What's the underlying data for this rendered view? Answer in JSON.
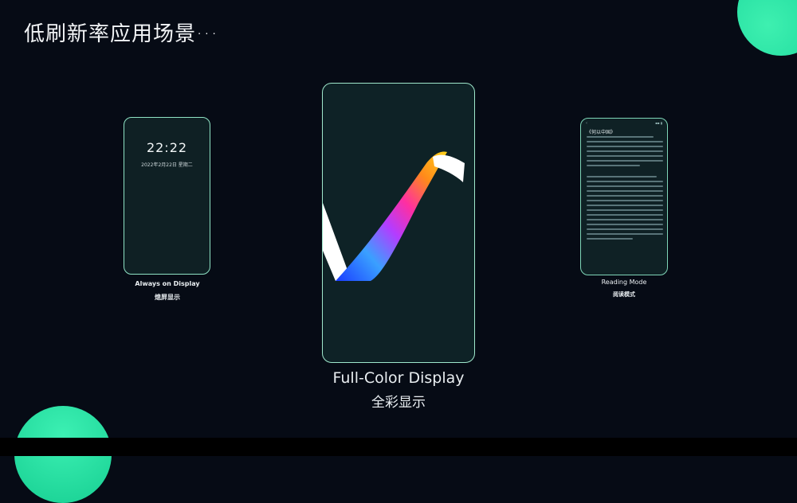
{
  "slide": {
    "title": "低刷新率应用场景···"
  },
  "phones": {
    "left": {
      "clock_time": "22:22",
      "date_text": "2022年2月22日 星期二",
      "label_en": "Always on Display",
      "label_zh": "熄屏显示"
    },
    "center": {
      "label_en": "Full-Color Display",
      "label_zh": "全彩显示"
    },
    "right": {
      "book_title": "《何以中国》",
      "label_en": "Reading Mode",
      "label_zh": "阅读模式"
    }
  },
  "colors": {
    "background": "#060b15",
    "accent_green": "#1fd89c",
    "phone_border": "#8fe3c5"
  },
  "icons": [
    "back-chevron-icon",
    "status-icons",
    "rainbow-logo-icon"
  ]
}
